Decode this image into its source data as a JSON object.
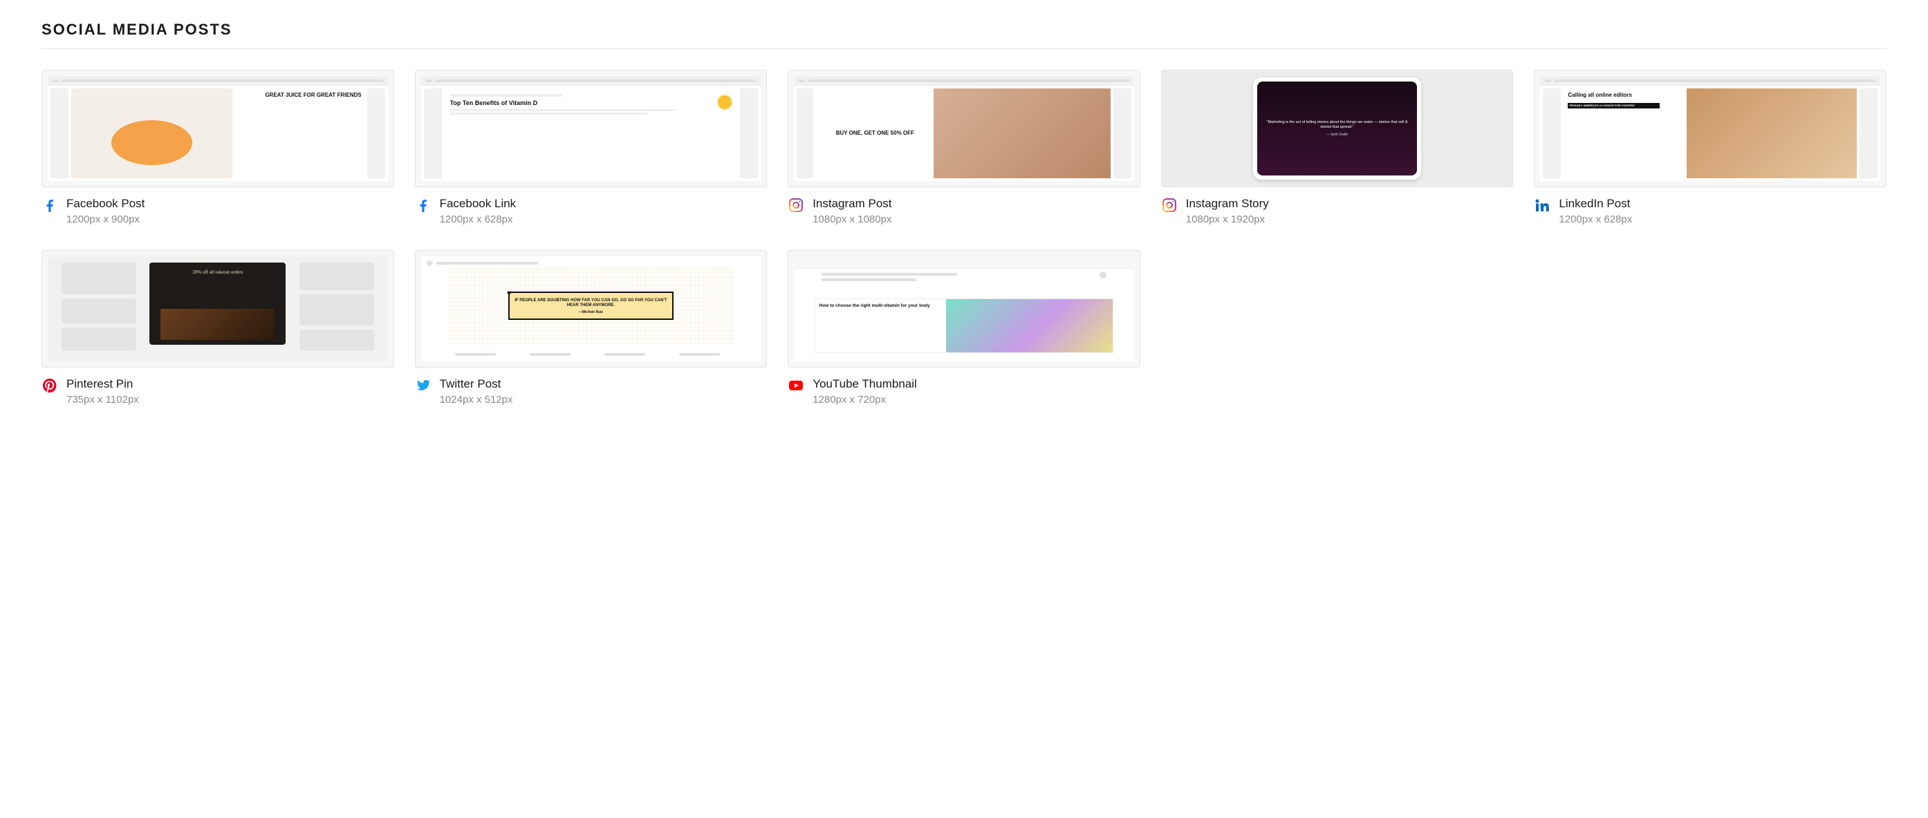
{
  "section_title": "SOCIAL MEDIA POSTS",
  "templates": [
    {
      "id": "facebook-post",
      "icon": "facebook",
      "title": "Facebook Post",
      "dims": "1200px x 900px",
      "preview_text": "GREAT JUICE FOR GREAT FRIENDS"
    },
    {
      "id": "facebook-link",
      "icon": "facebook",
      "title": "Facebook Link",
      "dims": "1200px x 628px",
      "preview_heading": "Top Ten Benefits of Vitamin D"
    },
    {
      "id": "instagram-post",
      "icon": "instagram",
      "title": "Instagram Post",
      "dims": "1080px x 1080px",
      "preview_text": "BUY ONE, GET ONE 50% OFF"
    },
    {
      "id": "instagram-story",
      "icon": "instagram",
      "title": "Instagram Story",
      "dims": "1080px x 1920px",
      "preview_text": "\"Marketing is the act of telling stories about the things we make — stories that sell & stories that spread.\"",
      "preview_attrib": "— Seth Godin"
    },
    {
      "id": "linkedin-post",
      "icon": "linkedin",
      "title": "LinkedIn Post",
      "dims": "1200px x 628px",
      "preview_text": "Calling all online editors",
      "preview_bar": "PROUDLY AMERICA'S #1 CHOICE FOR CONTENT"
    },
    {
      "id": "pinterest-pin",
      "icon": "pinterest",
      "title": "Pinterest Pin",
      "dims": "735px x 1102px",
      "preview_text": "20% off all takeout orders"
    },
    {
      "id": "twitter-post",
      "icon": "twitter",
      "title": "Twitter Post",
      "dims": "1024px x 512px",
      "preview_text": "IF PEOPLE ARE DOUBTING HOW FAR YOU CAN GO, GO SO FAR YOU CAN'T HEAR THEM ANYMORE.",
      "preview_attrib": "—Michele Ruiz"
    },
    {
      "id": "youtube-thumbnail",
      "icon": "youtube",
      "title": "YouTube Thumbnail",
      "dims": "1280px x 720px",
      "preview_text": "How to choose the right multi-vitamin for your body"
    }
  ]
}
